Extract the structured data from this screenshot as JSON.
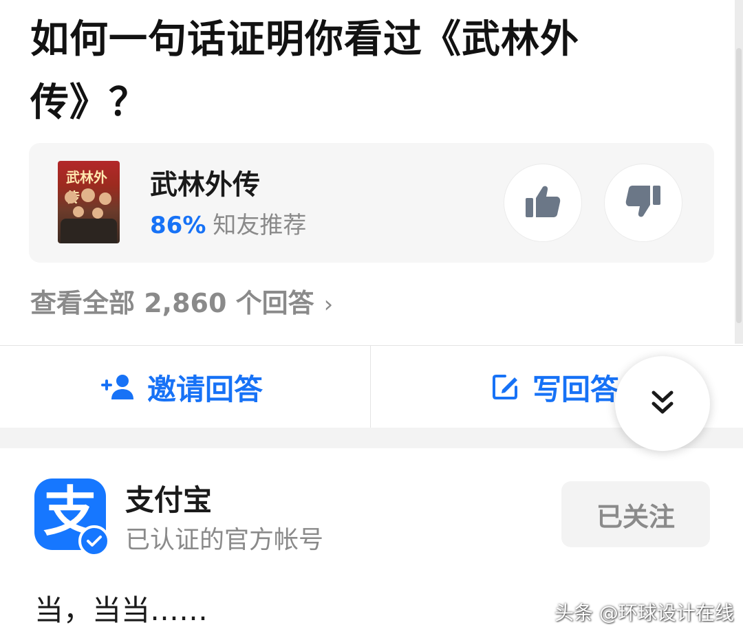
{
  "question": {
    "title": "如何一句话证明你看过《武林外传》？"
  },
  "card": {
    "name": "武林外传",
    "poster_text": "武林外传",
    "rating_percent": "86%",
    "rating_label": "知友推荐",
    "upvote_icon": "thumbs-up-icon",
    "downvote_icon": "thumbs-down-icon"
  },
  "view_all": {
    "label": "查看全部 2,860 个回答",
    "chevron": "›"
  },
  "actions": {
    "invite_label": "邀请回答",
    "invite_icon": "add-person-icon",
    "write_label": "写回答",
    "write_icon": "edit-icon"
  },
  "fab": {
    "icon": "double-chevron-down-icon"
  },
  "author": {
    "name": "支付宝",
    "description": "已认证的官方帐号",
    "avatar_glyph": "支",
    "follow_label": "已关注"
  },
  "answer": {
    "text": "当，当当……"
  },
  "watermark": {
    "text": "头条 @环球设计在线"
  },
  "colors": {
    "accent": "#1772f6",
    "brand": "#1677ff",
    "muted": "#8a8a8a"
  }
}
